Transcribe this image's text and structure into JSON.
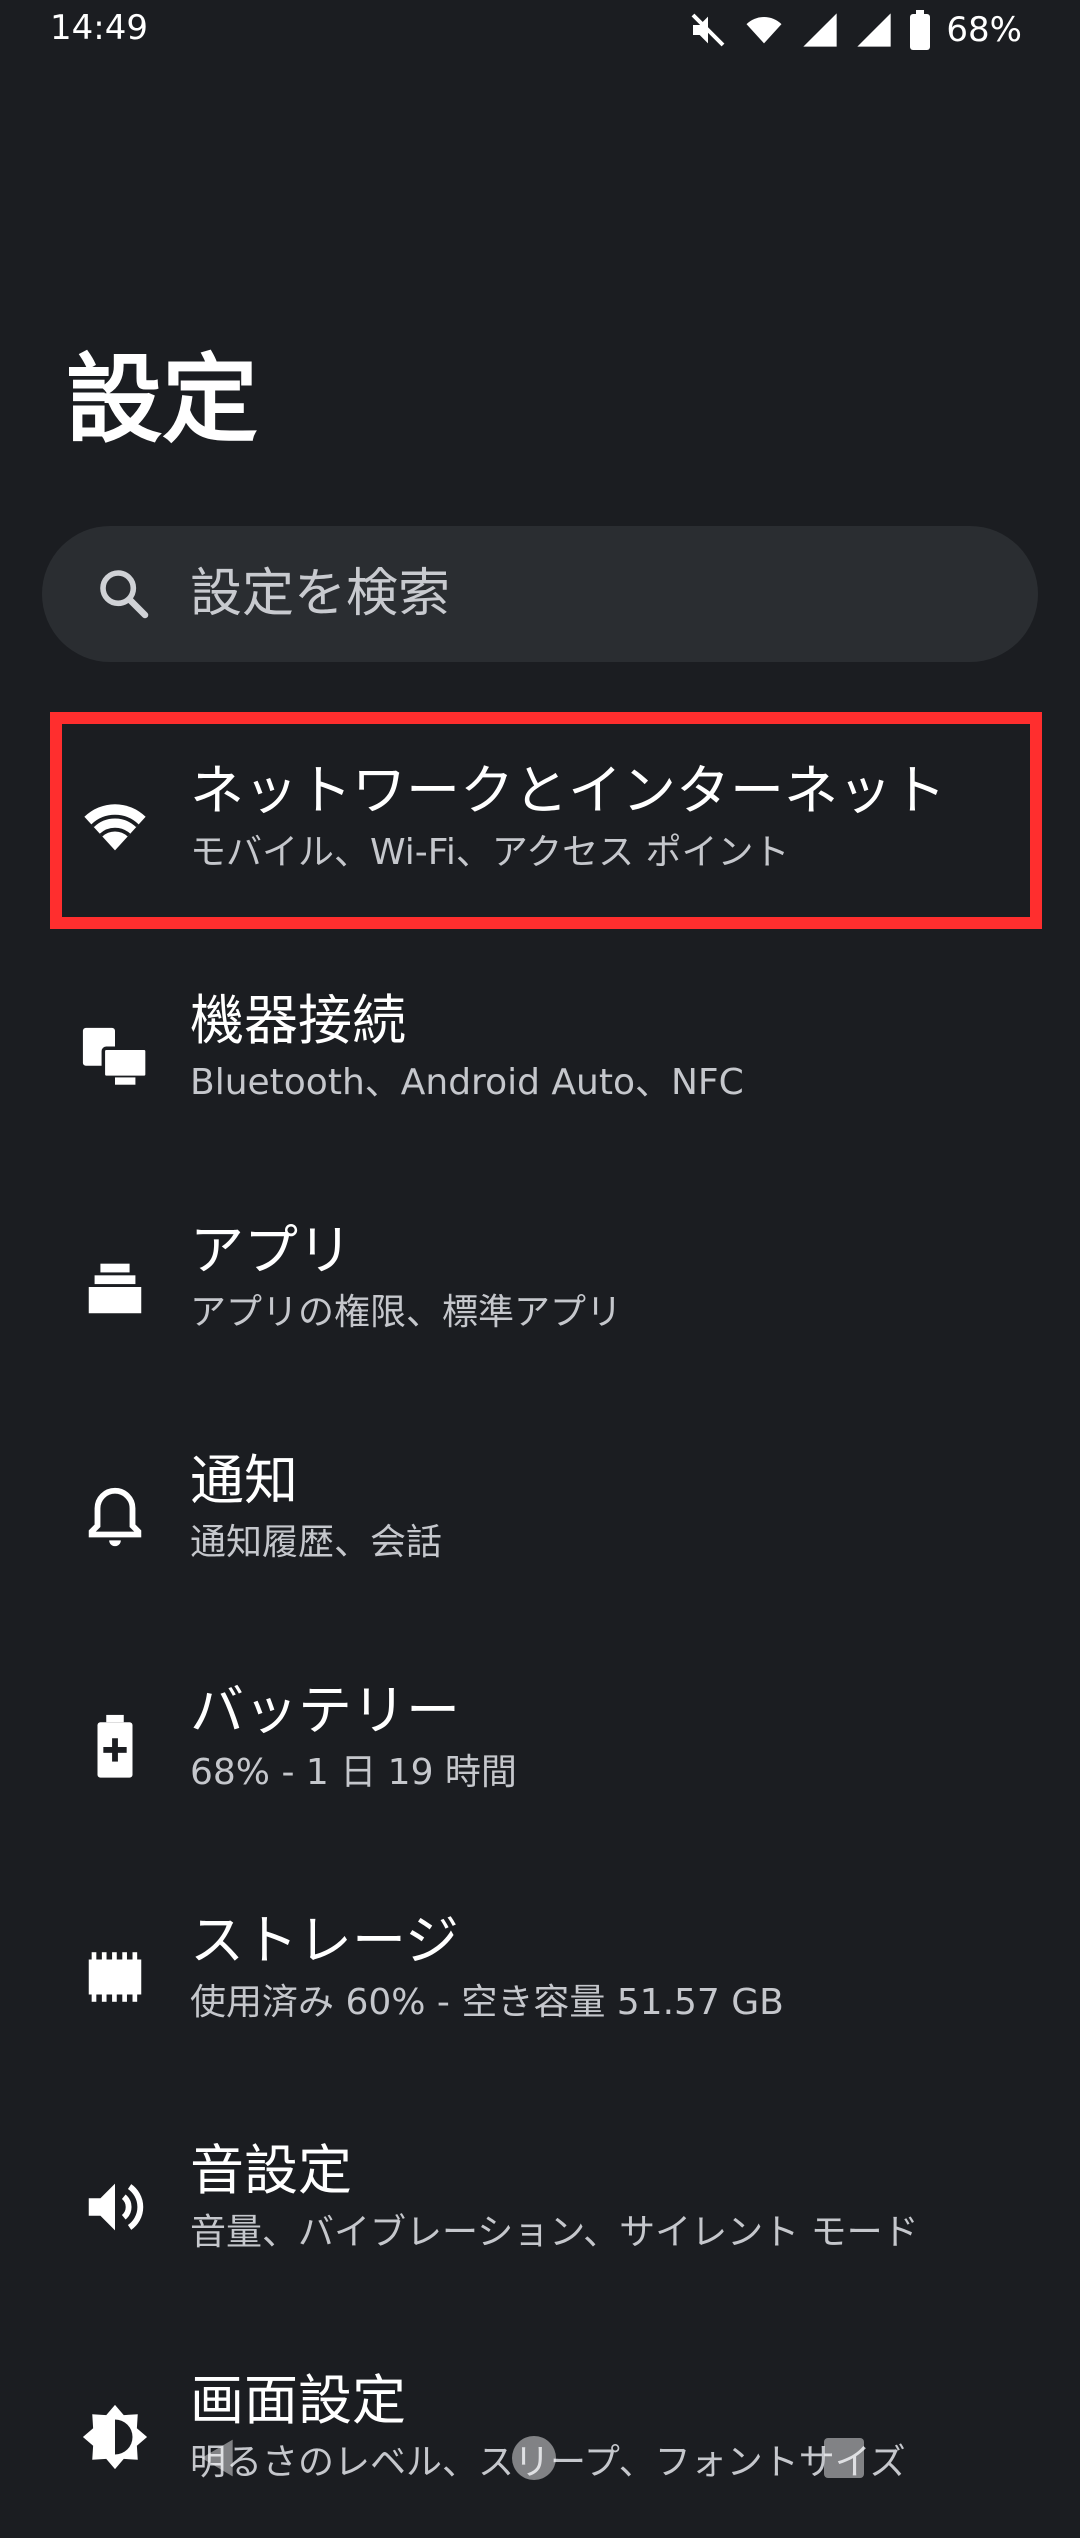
{
  "status_bar": {
    "time": "14:49",
    "battery_percent": "68%",
    "icons": [
      "mute-icon",
      "wifi-icon",
      "signal-icon",
      "signal-icon",
      "battery-icon"
    ]
  },
  "page_title": "設定",
  "search": {
    "placeholder": "設定を検索"
  },
  "items": [
    {
      "title": "ネットワークとインターネット",
      "subtitle": "モバイル、Wi-Fi、アクセス ポイント",
      "icon": "wifi-icon"
    },
    {
      "title": "機器接続",
      "subtitle": "Bluetooth、Android Auto、NFC",
      "icon": "devices-icon"
    },
    {
      "title": "アプリ",
      "subtitle": "アプリの権限、標準アプリ",
      "icon": "apps-icon"
    },
    {
      "title": "通知",
      "subtitle": "通知履歴、会話",
      "icon": "bell-icon"
    },
    {
      "title": "バッテリー",
      "subtitle": "68% - 1 日 19 時間",
      "icon": "battery-icon"
    },
    {
      "title": "ストレージ",
      "subtitle": "使用済み 60% - 空き容量 51.57 GB",
      "icon": "storage-icon"
    },
    {
      "title": "音設定",
      "subtitle": "音量、バイブレーション、サイレント モード",
      "icon": "volume-icon"
    },
    {
      "title": "画面設定",
      "subtitle": "明るさのレベル、スリープ、フォントサイズ",
      "icon": "brightness-icon"
    }
  ],
  "colors": {
    "background": "#1b1d21",
    "search_bg": "#2a2d31",
    "highlight": "#ff2e2e",
    "text_primary": "#ffffff",
    "text_secondary": "#c5c7cc"
  }
}
